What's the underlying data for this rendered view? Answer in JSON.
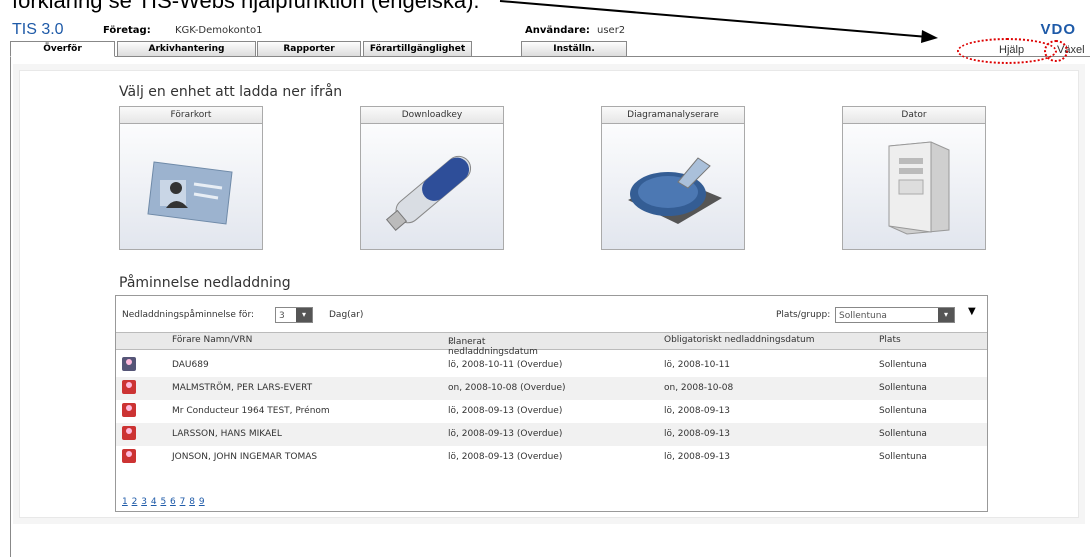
{
  "caption": "förklaring se TIS-Webs hjälpfunktion (engelska).",
  "app": {
    "title": "TIS 3.0",
    "brand": "VDO"
  },
  "header": {
    "company_label": "Företag:",
    "company_value": "KGK-Demokonto1",
    "user_label": "Användare:",
    "user_value": "user2"
  },
  "tabs": [
    "Överför",
    "Arkivhantering",
    "Rapporter",
    "Förartillgänglighet",
    "Inställn."
  ],
  "links": {
    "help": "Hjälp",
    "switch": "Växel"
  },
  "download": {
    "heading": "Välj en enhet att ladda ner ifrån",
    "devices": [
      "Förarkort",
      "Downloadkey",
      "Diagramanalyserare",
      "Dator"
    ]
  },
  "reminder": {
    "heading": "Påminnelse nedladdning",
    "for_label": "Nedladdningspåminnelse för:",
    "days_value": "3",
    "days_unit": "Dag(ar)",
    "place_label": "Plats/grupp:",
    "place_value": "Sollentuna",
    "columns": [
      "Förare Namn/VRN",
      "Planerat nedladdningsdatum",
      "Obligatoriskt nedladdningsdatum",
      "Plats"
    ],
    "sort_indicator": "⌄",
    "rows": [
      {
        "name": "DAU689",
        "planned": "lö, 2008-10-11 (Overdue)",
        "required": "lö, 2008-10-11",
        "place": "Sollentuna",
        "icon": "vehicle-icon"
      },
      {
        "name": "MALMSTRÖM, PER LARS-EVERT",
        "planned": "on, 2008-10-08 (Overdue)",
        "required": "on, 2008-10-08",
        "place": "Sollentuna",
        "icon": "driver-icon"
      },
      {
        "name": "Mr Conducteur 1964 TEST, Prénom",
        "planned": "lö, 2008-09-13 (Overdue)",
        "required": "lö, 2008-09-13",
        "place": "Sollentuna",
        "icon": "driver-icon"
      },
      {
        "name": "LARSSON, HANS MIKAEL",
        "planned": "lö, 2008-09-13 (Overdue)",
        "required": "lö, 2008-09-13",
        "place": "Sollentuna",
        "icon": "driver-icon"
      },
      {
        "name": "JONSON, JOHN INGEMAR TOMAS",
        "planned": "lö, 2008-09-13 (Overdue)",
        "required": "lö, 2008-09-13",
        "place": "Sollentuna",
        "icon": "driver-icon"
      }
    ],
    "pages": [
      "1",
      "2",
      "3",
      "4",
      "5",
      "6",
      "7",
      "8",
      "9"
    ]
  },
  "colors": {
    "brand": "#1e5aa8",
    "highlight": "#dd0000",
    "driver_icon": "#cc3333"
  }
}
